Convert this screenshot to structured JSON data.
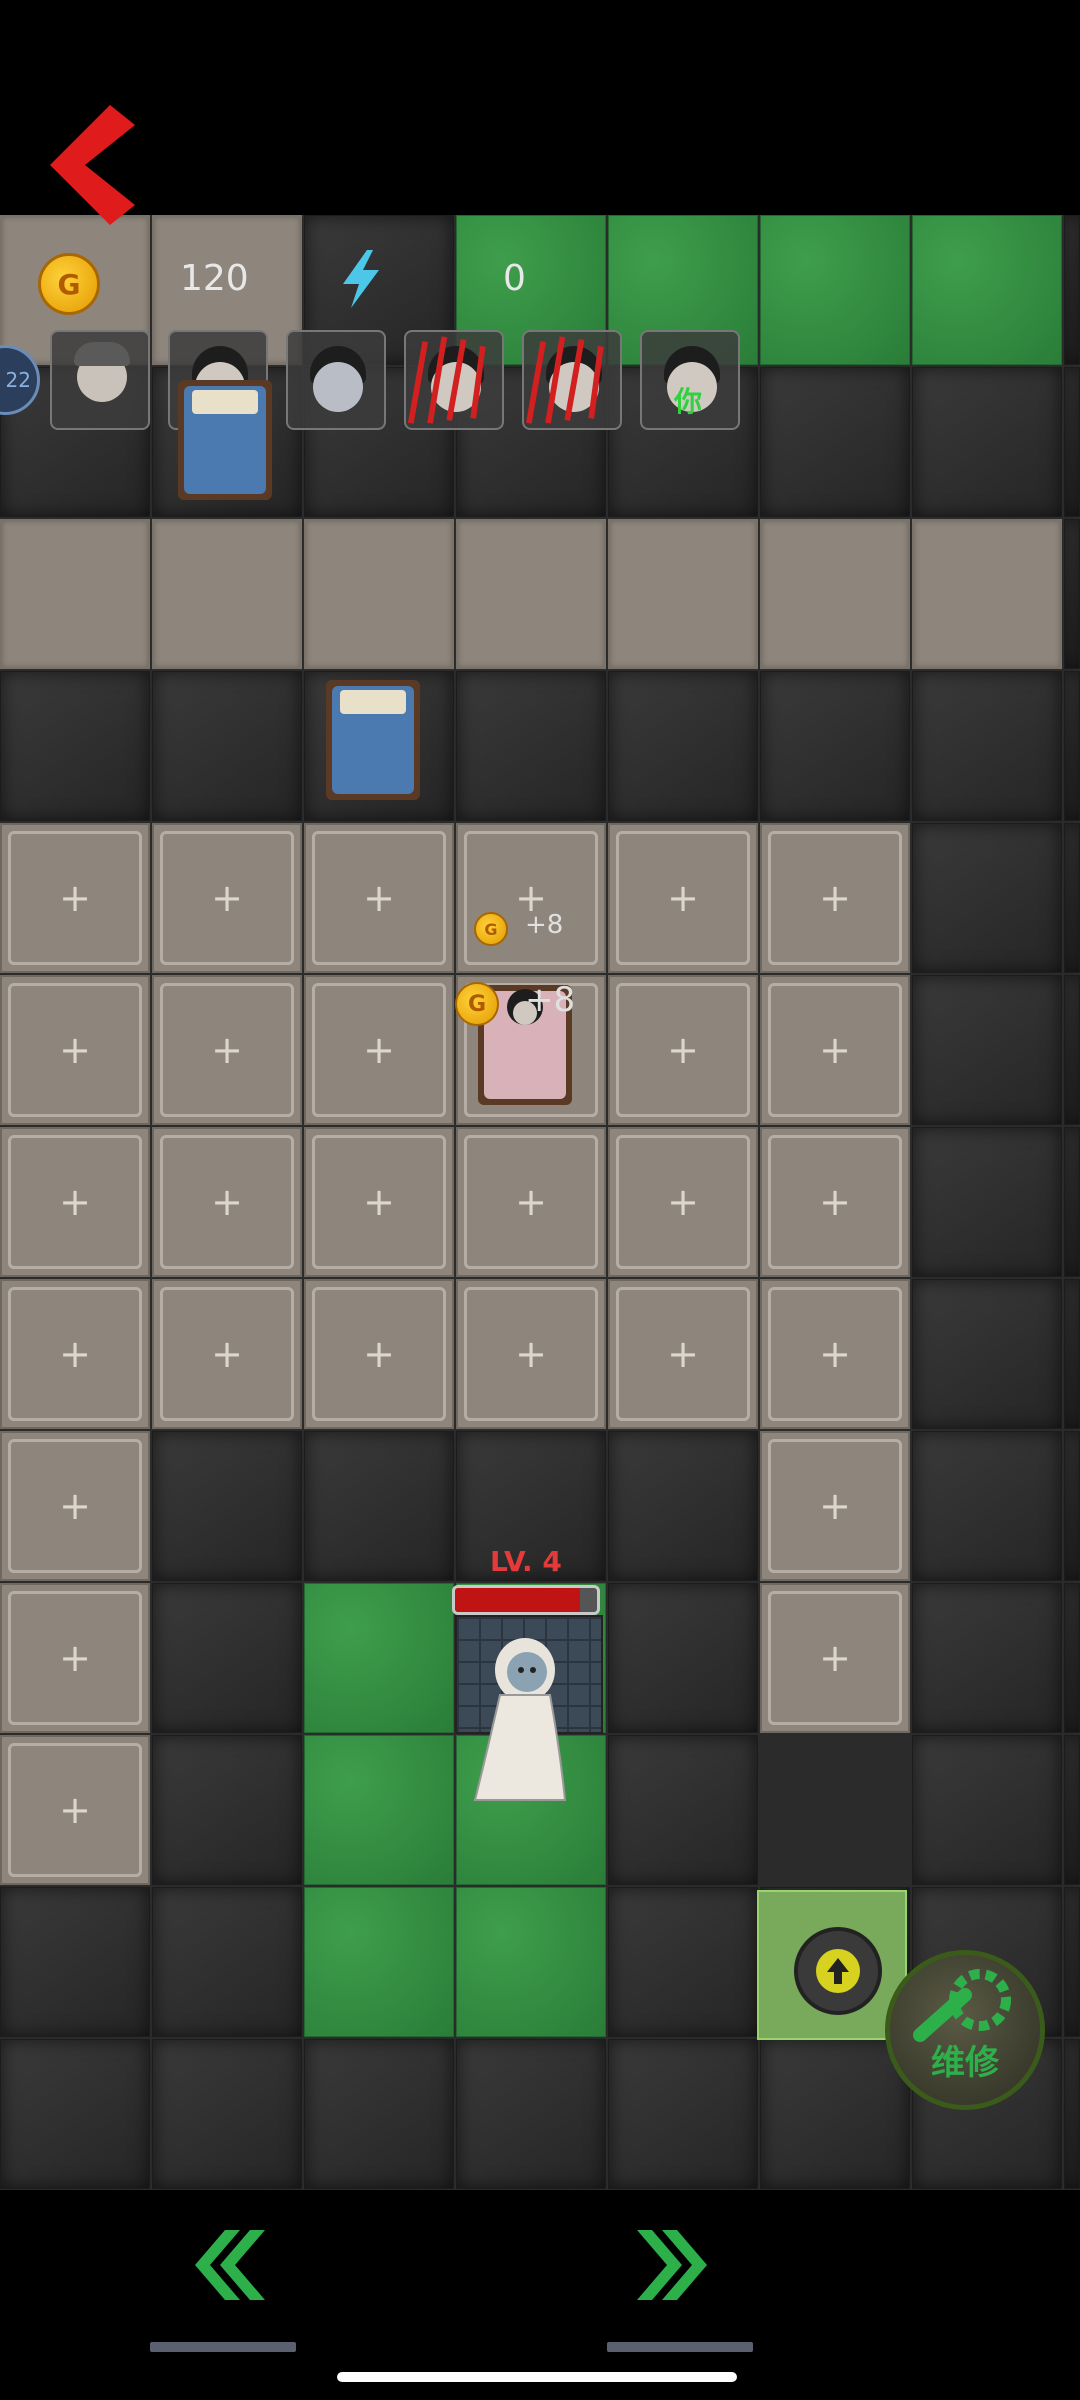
{
  "hud": {
    "gold_icon_letter": "G",
    "gold": "120",
    "energy": "0",
    "left_badge": "22"
  },
  "portraits": [
    {
      "name": "portrait-elder"
    },
    {
      "name": "portrait-girl-bow"
    },
    {
      "name": "portrait-pale-boy"
    },
    {
      "name": "portrait-clawed-1"
    },
    {
      "name": "portrait-clawed-2"
    },
    {
      "name": "portrait-you",
      "tag": "你"
    }
  ],
  "floating": {
    "gain_small": "+8",
    "gain_large": "+8"
  },
  "enemy": {
    "level_label": "LV. 4",
    "hp_fraction": 0.88
  },
  "buttons": {
    "repair_label": "维修"
  },
  "colors": {
    "accent_red": "#e02020",
    "grass": "#2f8a3e",
    "nav_green": "#2db04a"
  }
}
